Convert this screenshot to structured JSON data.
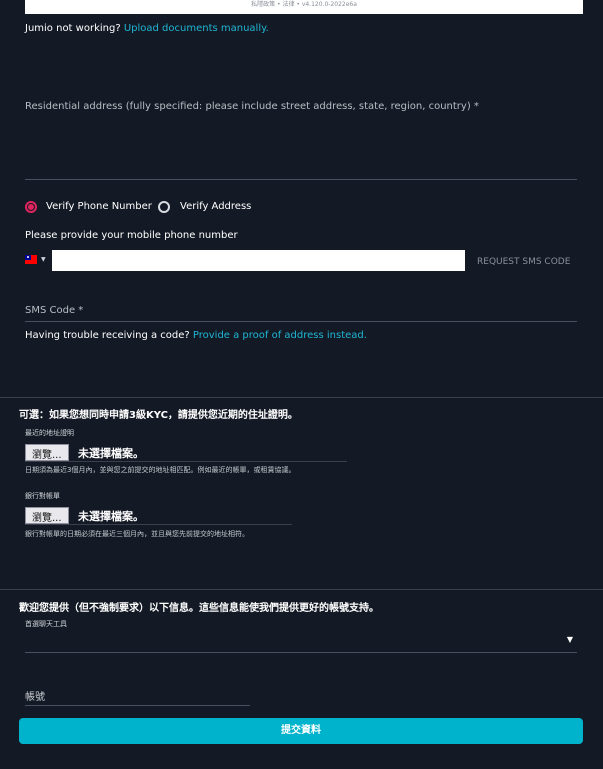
{
  "top_strip": {
    "text": "私隱政策 • 法律 • v4.120.0-2022e6a"
  },
  "jumio": {
    "text": "Jumio not working?",
    "link": "Upload documents manually."
  },
  "address": {
    "label": "Residential address (fully specified: please include street address, state, region, country) *"
  },
  "verify": {
    "options": [
      "Verify Phone Number",
      "Verify Address"
    ],
    "selected": "Verify Phone Number"
  },
  "phone": {
    "prompt": "Please provide your mobile phone number",
    "country_flag": "taiwan-flag-icon",
    "value": "",
    "request_sms": "REQUEST SMS CODE"
  },
  "sms": {
    "label": "SMS Code *",
    "trouble_text": "Having trouble receiving a code?",
    "trouble_link": "Provide a proof of address instead."
  },
  "optional_kyc": {
    "heading": "可選：如果您想同時申請3級KYC，請提供您近期的住址證明。",
    "recent_address": {
      "label": "最近的地址證明",
      "browse": "瀏覽...",
      "no_file": "未選擇檔案。",
      "hint": "日期須為最近3個月內，並與您之前提交的地址相匹配。例如最近的帳單，或租賃協議。"
    },
    "bank_statement": {
      "label": "銀行對帳單",
      "browse": "瀏覽...",
      "no_file": "未選擇檔案。",
      "hint": "銀行對帳單的日期必須在最近三個月內，並且與您先前提交的地址相符。"
    }
  },
  "extra_info": {
    "heading": "歡迎您提供（但不強制要求）以下信息。這些信息能使我們提供更好的帳號支持。",
    "chat_tool_label": "首選聊天工具",
    "chat_tool_value": "",
    "account_label": "帳號"
  },
  "submit": {
    "label": "提交資料"
  },
  "colors": {
    "background": "#141a25",
    "accent": "#00b3cc",
    "radio_selected": "#e0245e",
    "link": "#1fb6d4"
  }
}
